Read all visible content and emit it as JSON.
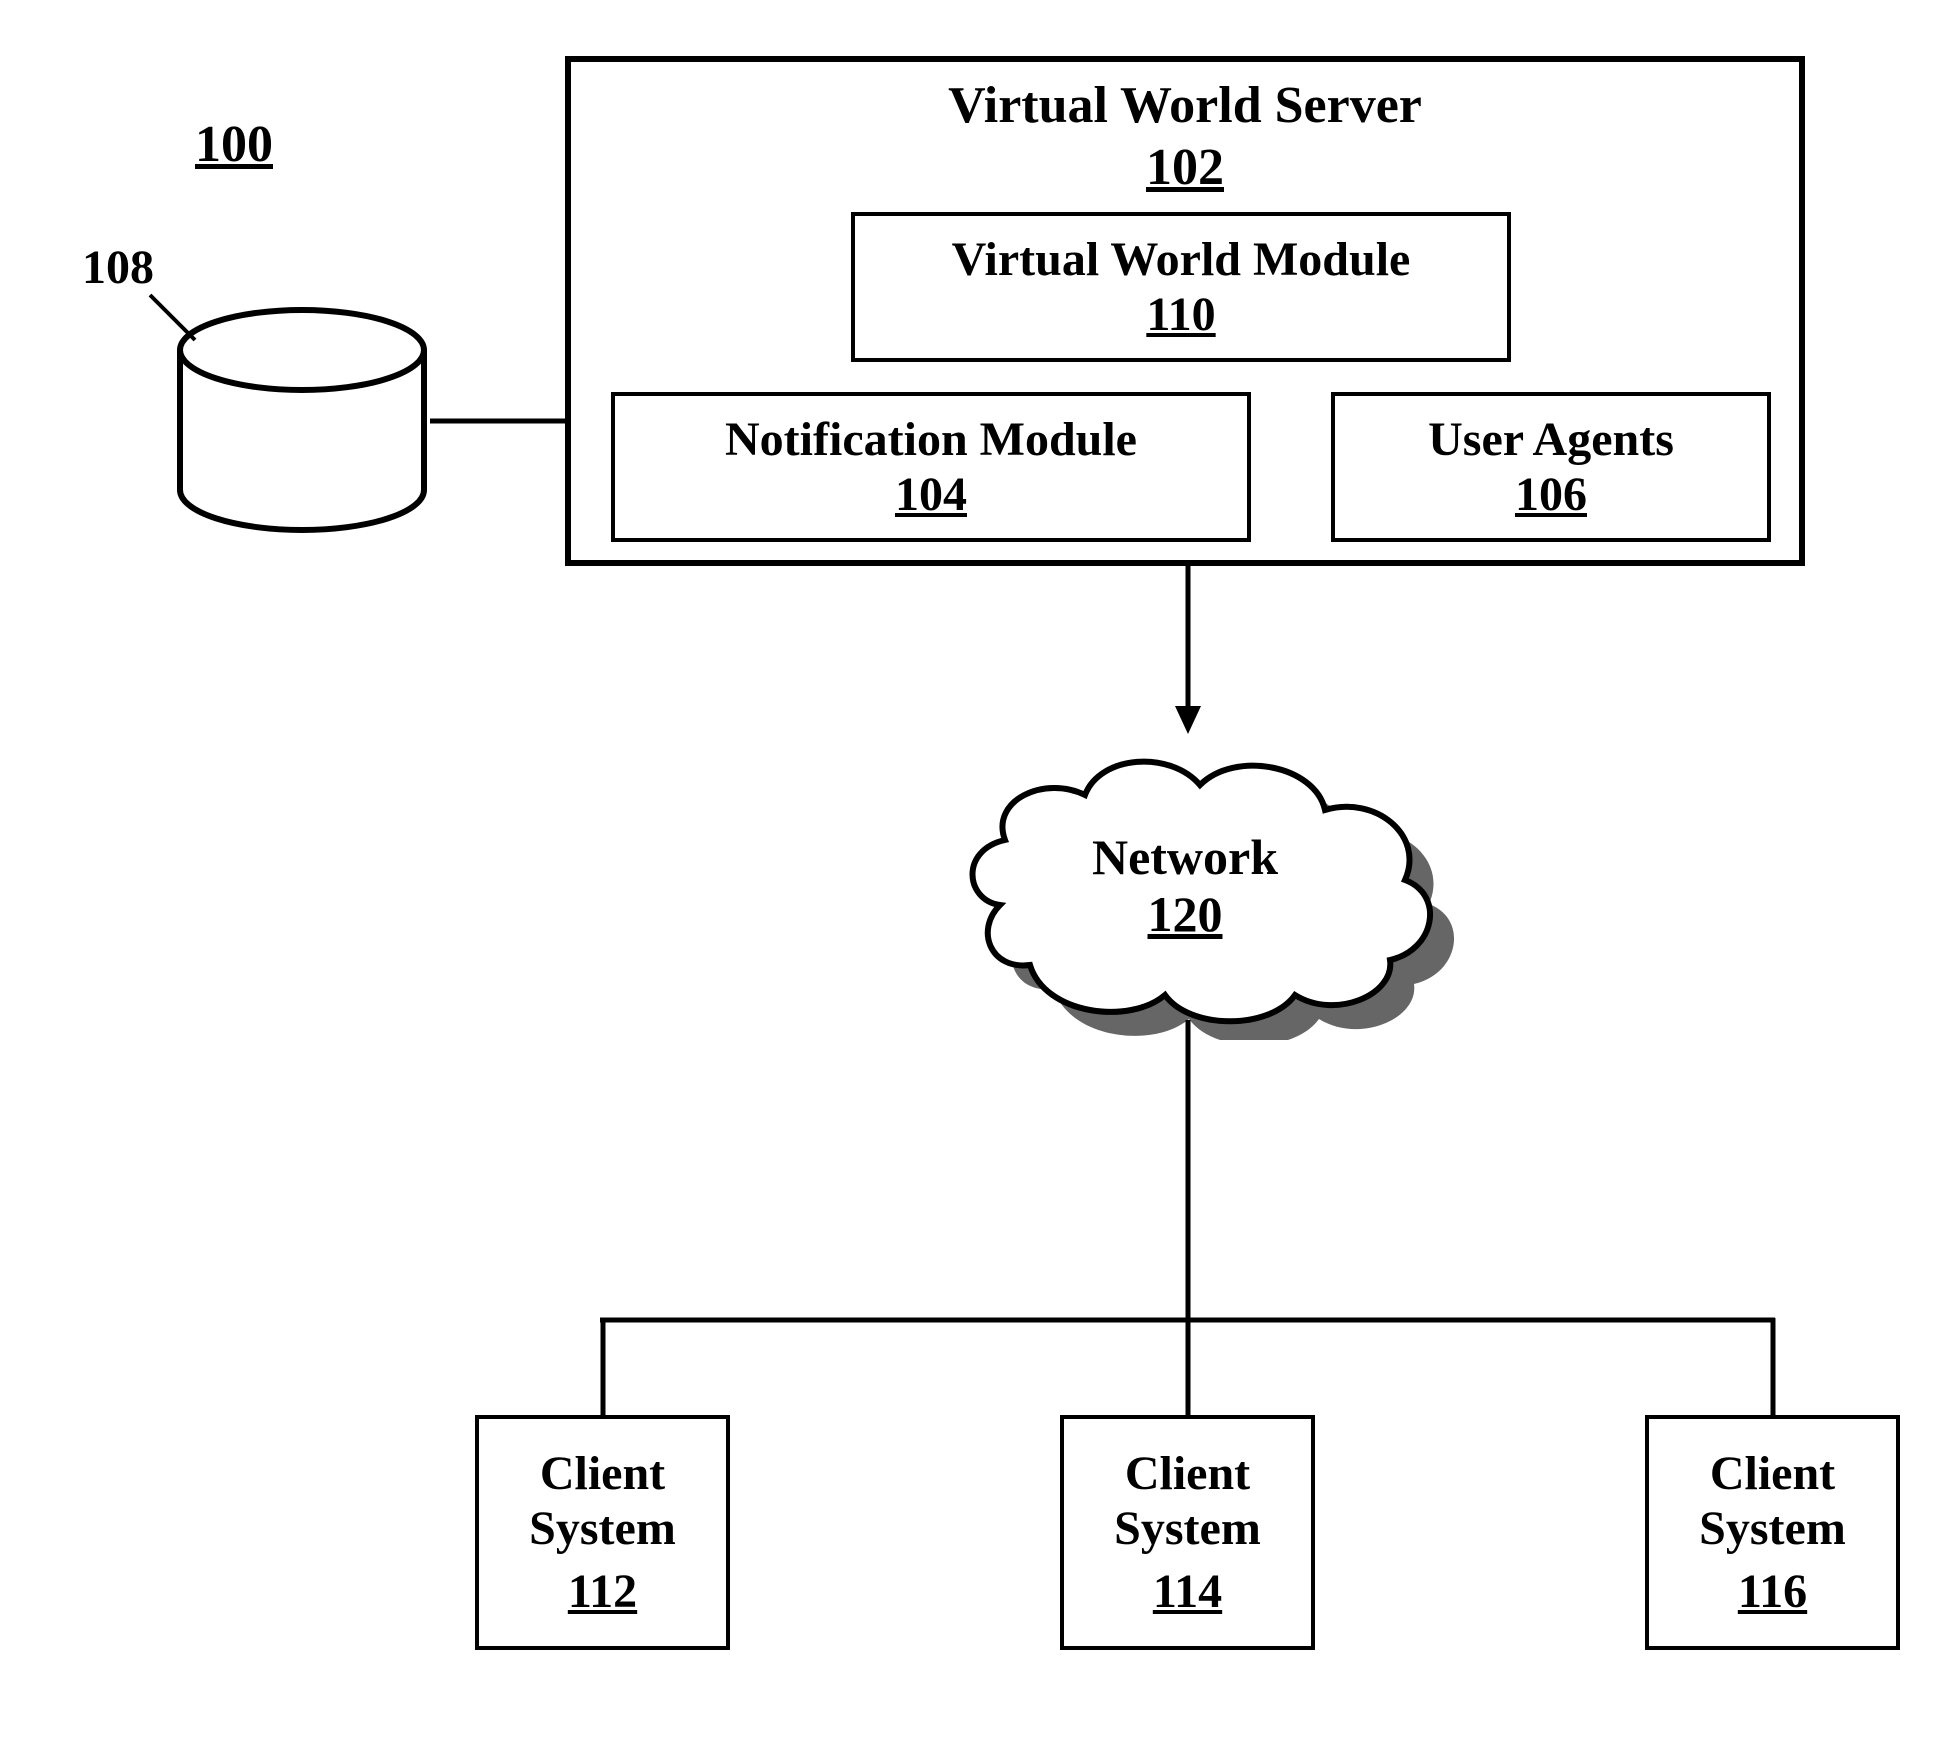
{
  "figure": {
    "figure_ref": "100",
    "database_ref": "108",
    "server": {
      "title": "Virtual World Server",
      "ref": "102",
      "virtual_world_module": {
        "title": "Virtual World Module",
        "ref": "110"
      },
      "notification_module": {
        "title": "Notification Module",
        "ref": "104"
      },
      "user_agents": {
        "title": "User Agents",
        "ref": "106"
      }
    },
    "network": {
      "title": "Network",
      "ref": "120"
    },
    "clients": [
      {
        "title1": "Client",
        "title2": "System",
        "ref": "112"
      },
      {
        "title1": "Client",
        "title2": "System",
        "ref": "114"
      },
      {
        "title1": "Client",
        "title2": "System",
        "ref": "116"
      }
    ]
  }
}
